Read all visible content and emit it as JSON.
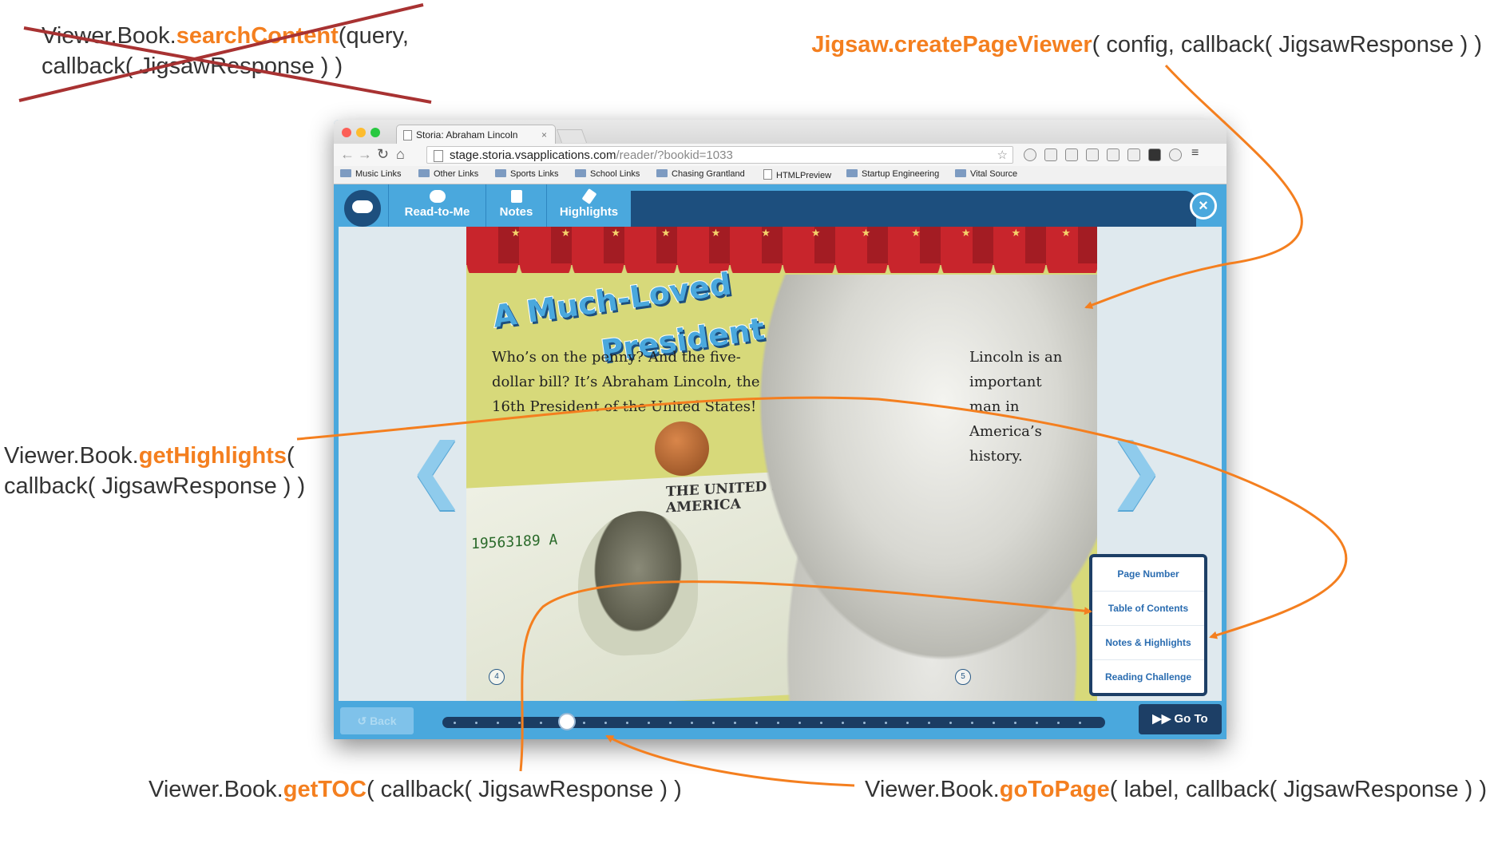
{
  "annotations": {
    "search": {
      "prefix": "Viewer.Book.",
      "fn": "searchContent",
      "line1_rest": "(query,",
      "line2": "callback( JigsawResponse ) )"
    },
    "create": {
      "fn": "Jigsaw.createPageViewer",
      "rest": "( config, callback( JigsawResponse ) )"
    },
    "highlights": {
      "prefix": "Viewer.Book.",
      "fn": "getHighlights",
      "line1_rest": "(",
      "line2": "callback( JigsawResponse ) )"
    },
    "toc": {
      "prefix": "Viewer.Book.",
      "fn": "getTOC",
      "rest": "( callback( JigsawResponse ) )"
    },
    "goto": {
      "prefix": "Viewer.Book.",
      "fn": "goToPage",
      "rest": "( label, callback( JigsawResponse ) )"
    }
  },
  "browser": {
    "tab_title": "Storia: Abraham Lincoln",
    "tab_close": "×",
    "url_host": "stage.storia.vsapplications.com",
    "url_path": "/reader/?bookid=1033",
    "bookmarks": [
      {
        "label": "Music Links",
        "type": "folder"
      },
      {
        "label": "Other Links",
        "type": "folder"
      },
      {
        "label": "Sports Links",
        "type": "folder"
      },
      {
        "label": "School Links",
        "type": "folder"
      },
      {
        "label": "Chasing Grantland",
        "type": "folder"
      },
      {
        "label": "HTMLPreview",
        "type": "page"
      },
      {
        "label": "Startup Engineering",
        "type": "folder"
      },
      {
        "label": "Vital Source",
        "type": "folder"
      }
    ]
  },
  "app": {
    "buttons": {
      "read_to_me": "Read-to-Me",
      "notes": "Notes",
      "highlights": "Highlights"
    },
    "close": "×",
    "back": "↺ Back",
    "goto": "▶▶ Go To",
    "goto_menu": [
      "Page Number",
      "Table of Contents",
      "Notes & Highlights",
      "Reading Challenge"
    ],
    "slider_position_fraction": 0.18
  },
  "book": {
    "title_line1": "A Much-Loved",
    "title_line2": "President",
    "body_left": "Who’s on the penny? And the five-dollar bill? It’s Abraham Lincoln, the 16th President of the United States!",
    "body_right": "Lincoln is an important man in America’s history.",
    "dollar_serial": "19563189 A",
    "dollar_text": "THE UNITED STATES OF AMERICA",
    "page_left": "4",
    "page_right": "5"
  },
  "colors": {
    "accent": "#f47f1f",
    "app_blue": "#4aa8dd",
    "navy": "#1d4f7e",
    "strike": "#a83232"
  }
}
